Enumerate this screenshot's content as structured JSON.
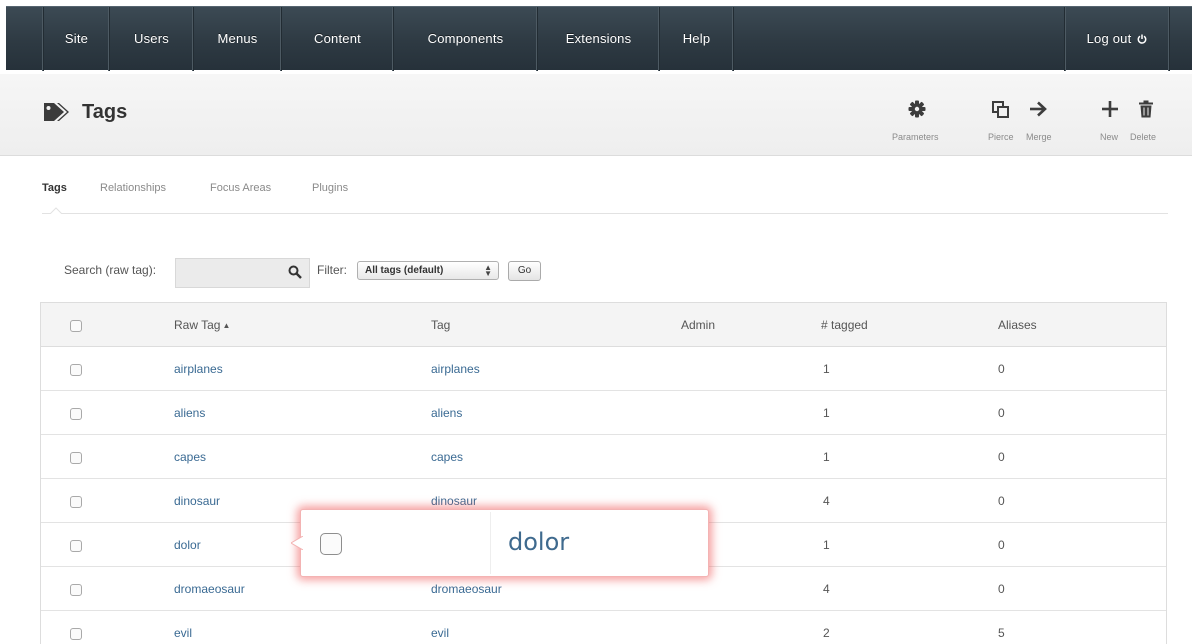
{
  "nav": {
    "items": [
      "Site",
      "Users",
      "Menus",
      "Content",
      "Components",
      "Extensions",
      "Help"
    ],
    "logout_label": "Log out"
  },
  "page": {
    "title": "Tags",
    "icon": "tags-icon"
  },
  "toolbar": {
    "parameters_label": "Parameters",
    "pierce_label": "Pierce",
    "merge_label": "Merge",
    "new_label": "New",
    "delete_label": "Delete"
  },
  "subtabs": {
    "items": [
      "Tags",
      "Relationships",
      "Focus Areas",
      "Plugins"
    ],
    "active": "Tags"
  },
  "search": {
    "label": "Search (raw tag):",
    "value": "",
    "filter_label": "Filter:",
    "filter_selected": "All tags (default)",
    "go_label": "Go"
  },
  "table": {
    "columns": [
      "Raw Tag",
      "Tag",
      "Admin",
      "# tagged",
      "Aliases"
    ],
    "sort_column": "Raw Tag",
    "sort_direction": "ascending",
    "rows": [
      {
        "raw": "airplanes",
        "tag": "airplanes",
        "admin": "",
        "tagged": "1",
        "aliases": "0"
      },
      {
        "raw": "aliens",
        "tag": "aliens",
        "admin": "",
        "tagged": "1",
        "aliases": "0"
      },
      {
        "raw": "capes",
        "tag": "capes",
        "admin": "",
        "tagged": "1",
        "aliases": "0"
      },
      {
        "raw": "dinosaur",
        "tag": "dinosaur",
        "admin": "",
        "tagged": "4",
        "aliases": "0"
      },
      {
        "raw": "dolor",
        "tag": "",
        "admin": "",
        "tagged": "1",
        "aliases": "0"
      },
      {
        "raw": "dromaeosaur",
        "tag": "dromaeosaur",
        "admin": "",
        "tagged": "4",
        "aliases": "0"
      },
      {
        "raw": "evil",
        "tag": "evil",
        "admin": "",
        "tagged": "2",
        "aliases": "5"
      }
    ]
  },
  "callout": {
    "text": "dolor"
  },
  "colors": {
    "nav_bg": "#2e3a43",
    "link": "#3a6a93",
    "callout_glow": "#ee5050"
  }
}
